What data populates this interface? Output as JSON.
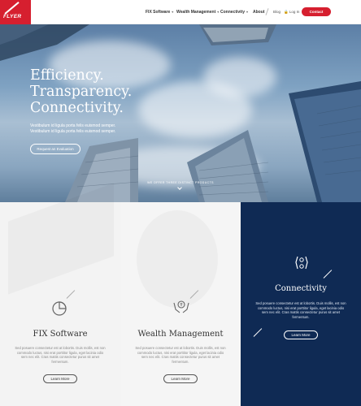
{
  "header": {
    "logo_text": "FLYER",
    "nav": [
      {
        "label": "FIX Software"
      },
      {
        "label": "Wealth Management"
      },
      {
        "label": "Connectivity"
      },
      {
        "label": "About"
      }
    ],
    "blog": "Blog",
    "login": "Log In",
    "contact": "Contact"
  },
  "hero": {
    "headline": [
      "Efficiency.",
      "Transparency.",
      "Connectivity."
    ],
    "sub": "Vestibulum id ligula porta felis euismod semper. Vestibulum id ligula porta felis euismod semper.",
    "cta": "Request an Evaluation",
    "offer": "WE OFFER THREE DISTINCT PRODUCTS"
  },
  "panels": [
    {
      "title": "FIX Software",
      "text": "Sed posuere consectetur est at lobortis. Duis mollis, est non commodo luctus, nisi erat porttitor ligula, eget lacinia odio sem nec elit. Cras mattis consectetur purus sit amet fermentum.",
      "button": "Learn More",
      "icon": "pie-chart-icon"
    },
    {
      "title": "Wealth Management",
      "text": "Sed posuere consectetur est at lobortis. Duis mollis, est non commodo luctus, nisi erat porttitor ligula, eget lacinia odio sem nec elit. Cras mattis consectetur purus sit amet fermentum.",
      "button": "Learn More",
      "icon": "hands-coin-icon"
    },
    {
      "title": "Connectivity",
      "text": "Sed posuere consectetur est at lobortis. Duis mollis, est non commodo luctus, nisi erat porttitor ligula, eget lacinia odio sem nec elit. Cras mattis consectetur purus sit amet fermentum.",
      "button": "Learn More",
      "icon": "connect-hands-icon"
    }
  ],
  "colors": {
    "brand": "#d61f2f",
    "navy": "#0f2a54"
  }
}
